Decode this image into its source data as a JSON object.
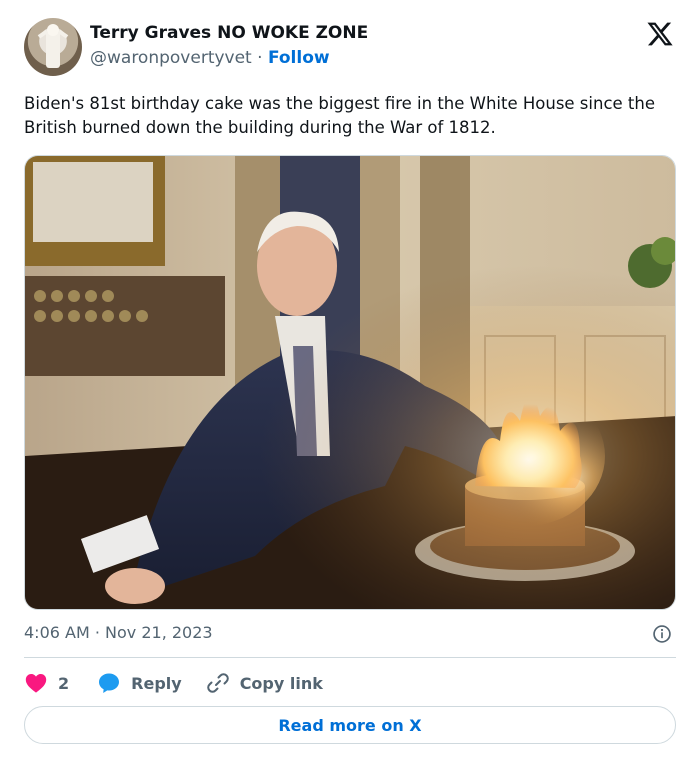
{
  "author": {
    "display_name": "Terry Graves NO WOKE ZONE",
    "handle": "@waronpovertyvet",
    "separator": "·",
    "follow_label": "Follow"
  },
  "tweet": {
    "text": "Biden's 81st birthday cake was the biggest fire in the White House since the British burned down the building during the War of 1812.",
    "timestamp": "4:06 AM · Nov 21, 2023"
  },
  "actions": {
    "like_count": "2",
    "reply_label": "Reply",
    "copy_link_label": "Copy link"
  },
  "read_more_label": "Read more on X",
  "icons": {
    "brand": "x-logo-icon",
    "like": "heart-icon",
    "reply": "speech-bubble-icon",
    "copy": "link-icon",
    "info": "info-icon"
  },
  "colors": {
    "link": "#006fd6",
    "like": "#f91880",
    "reply": "#1d9bf0",
    "muted": "#536471",
    "border": "#cfd9de"
  }
}
